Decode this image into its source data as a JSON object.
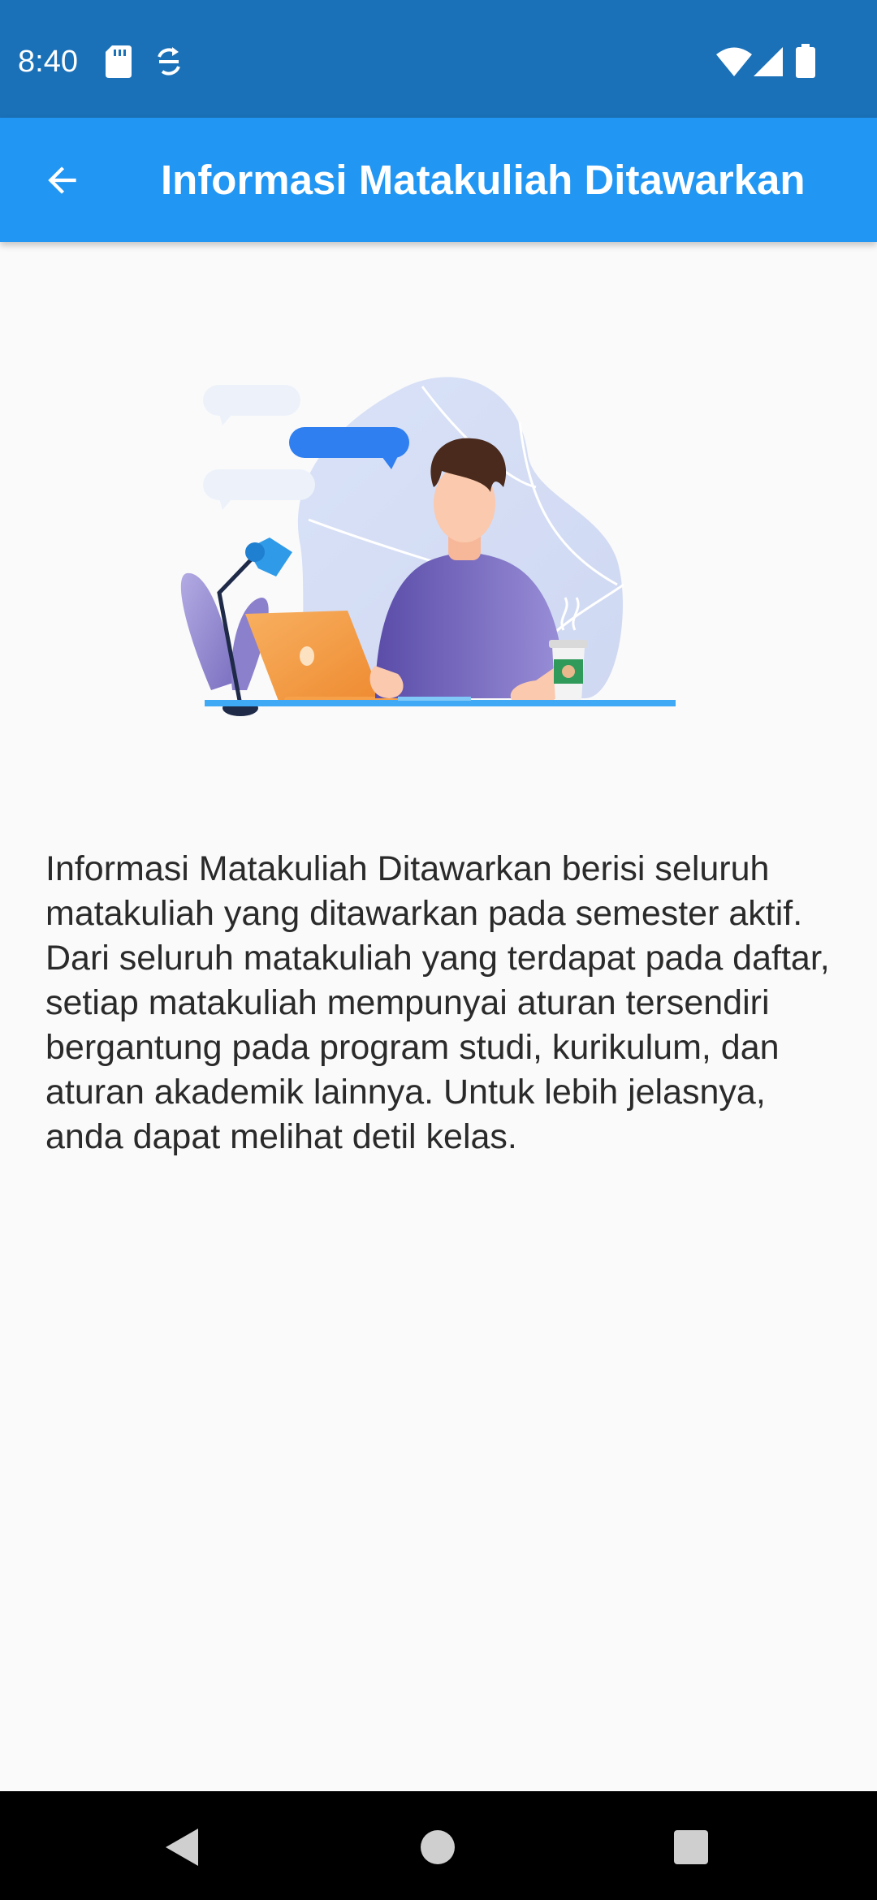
{
  "status_bar": {
    "time": "8:40",
    "icons": [
      "sd-card-icon",
      "sync-icon",
      "wifi-icon",
      "signal-icon",
      "battery-icon"
    ]
  },
  "app_bar": {
    "back_icon": "arrow-back-icon",
    "title": "Informasi Matakuliah Ditawarkan"
  },
  "illustration": {
    "subject": "person-working-on-laptop-illustration"
  },
  "content": {
    "description": "Informasi Matakuliah Ditawarkan berisi seluruh matakuliah yang ditawarkan pada semester aktif. Dari seluruh matakuliah yang terdapat pada daftar, setiap matakuliah mempunyai aturan tersendiri bergantung pada program studi, kurikulum, dan aturan akademik lainnya. Untuk lebih jelasnya, anda dapat melihat detil kelas."
  },
  "nav_bar": {
    "icons": [
      "nav-back-icon",
      "nav-home-icon",
      "nav-recents-icon"
    ]
  },
  "colors": {
    "status_bar": "#1a71b8",
    "app_bar": "#2196f3",
    "background": "#fafafa",
    "text": "#2a2a2a",
    "nav_bar": "#000000"
  }
}
